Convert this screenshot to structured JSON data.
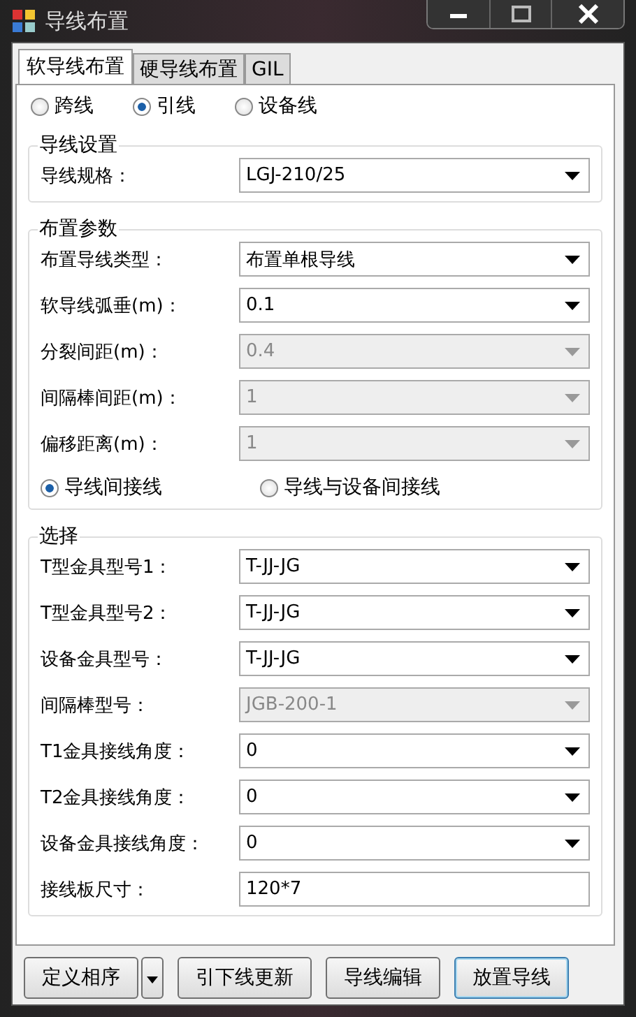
{
  "window": {
    "title": "导线布置"
  },
  "tabs": [
    {
      "label": "软导线布置",
      "selected": true
    },
    {
      "label": "硬导线布置",
      "selected": false
    },
    {
      "label": "GIL",
      "selected": false
    }
  ],
  "line_type": [
    {
      "label": "跨线",
      "selected": false
    },
    {
      "label": "引线",
      "selected": true
    },
    {
      "label": "设备线",
      "selected": false
    }
  ],
  "groups": [
    {
      "title": "导线设置",
      "fields": [
        {
          "label": "导线规格：",
          "value": "LGJ-210/25",
          "kind": "dropdown",
          "disabled": false
        }
      ]
    },
    {
      "title": "布置参数",
      "fields": [
        {
          "label": "布置导线类型：",
          "value": "布置单根导线",
          "kind": "dropdown",
          "disabled": false
        },
        {
          "label": "软导线弧垂(m)：",
          "value": "0.1",
          "kind": "dropdown",
          "disabled": false
        },
        {
          "label": "分裂间距(m)：",
          "value": "0.4",
          "kind": "dropdown",
          "disabled": true
        },
        {
          "label": "间隔棒间距(m)：",
          "value": "1",
          "kind": "dropdown",
          "disabled": true
        },
        {
          "label": "偏移距离(m)：",
          "value": "1",
          "kind": "dropdown",
          "disabled": true
        }
      ],
      "radios": [
        {
          "label": "导线间接线",
          "selected": true
        },
        {
          "label": "导线与设备间接线",
          "selected": false
        }
      ]
    },
    {
      "title": "选择",
      "fields": [
        {
          "label": "T型金具型号1：",
          "value": "T-JJ-JG",
          "kind": "dropdown",
          "disabled": false
        },
        {
          "label": "T型金具型号2：",
          "value": "T-JJ-JG",
          "kind": "dropdown",
          "disabled": false
        },
        {
          "label": "设备金具型号：",
          "value": "T-JJ-JG",
          "kind": "dropdown",
          "disabled": false
        },
        {
          "label": "间隔棒型号：",
          "value": "JGB-200-1",
          "kind": "dropdown",
          "disabled": true
        },
        {
          "label": "T1金具接线角度：",
          "value": "0",
          "kind": "dropdown",
          "disabled": false
        },
        {
          "label": "T2金具接线角度：",
          "value": "0",
          "kind": "dropdown",
          "disabled": false
        },
        {
          "label": "设备金具接线角度：",
          "value": "0",
          "kind": "dropdown",
          "disabled": false
        },
        {
          "label": "接线板尺寸：",
          "value": "120*7",
          "kind": "text",
          "disabled": false
        }
      ]
    }
  ],
  "buttons": [
    {
      "label": "定义相序",
      "kind": "split",
      "default": false
    },
    {
      "label": "引下线更新",
      "kind": "plain",
      "default": false
    },
    {
      "label": "导线编辑",
      "kind": "plain",
      "default": false
    },
    {
      "label": "放置导线",
      "kind": "plain",
      "default": true
    }
  ]
}
